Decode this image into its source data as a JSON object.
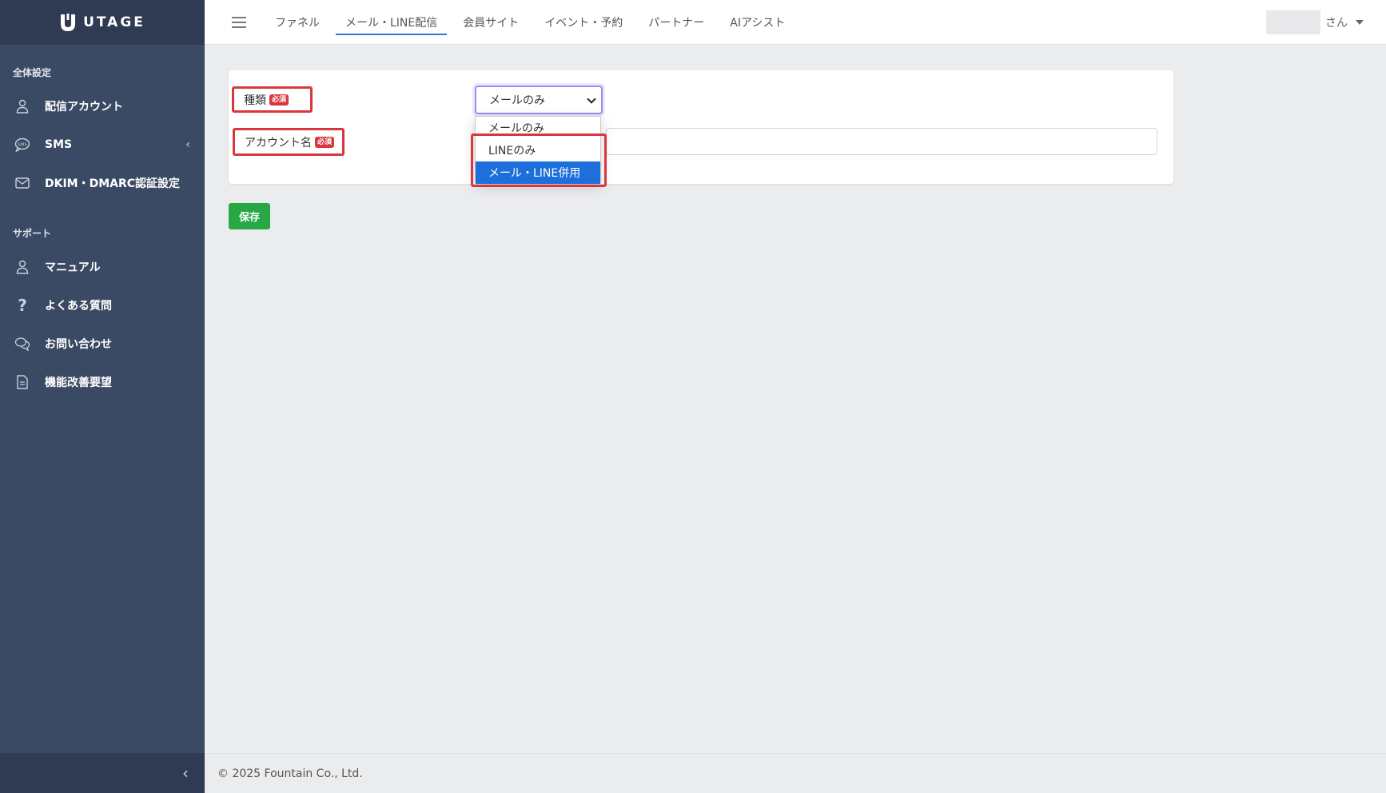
{
  "brand": {
    "name": "UTAGE"
  },
  "sidebar": {
    "section_general": "全体設定",
    "general_items": [
      {
        "label": "配信アカウント",
        "icon": "user-icon"
      },
      {
        "label": "SMS",
        "icon": "sms-bubble-icon",
        "has_chevron": true
      },
      {
        "label": "DKIM・DMARC認証設定",
        "icon": "envelope-icon"
      }
    ],
    "section_support": "サポート",
    "support_items": [
      {
        "label": "マニュアル",
        "icon": "user-icon"
      },
      {
        "label": "よくある質問",
        "icon": "question-icon"
      },
      {
        "label": "お問い合わせ",
        "icon": "chat-icon"
      },
      {
        "label": "機能改善要望",
        "icon": "document-icon"
      }
    ],
    "collapse_glyph": "‹"
  },
  "header": {
    "tabs": [
      {
        "label": "ファネル",
        "active": false
      },
      {
        "label": "メール・LINE配信",
        "active": true
      },
      {
        "label": "会員サイト",
        "active": false
      },
      {
        "label": "イベント・予約",
        "active": false
      },
      {
        "label": "パートナー",
        "active": false
      },
      {
        "label": "AIアシスト",
        "active": false
      }
    ],
    "user_suffix": "さん"
  },
  "form": {
    "type_label": "種類",
    "account_name_label": "アカウント名",
    "required_badge": "必須",
    "type_select": {
      "value": "メールのみ",
      "options": [
        "メールのみ",
        "LINEのみ",
        "メール・LINE併用"
      ],
      "highlighted_option": "メール・LINE併用"
    },
    "account_name_value": ""
  },
  "actions": {
    "save_label": "保存"
  },
  "footer": {
    "copyright": "© 2025 Fountain Co., Ltd."
  },
  "colors": {
    "sidebar_bg": "#3b4a64",
    "sidebar_dark": "#2f3b52",
    "accent_blue": "#1d6fdc",
    "highlight_red": "#d9363e",
    "save_green": "#28a745"
  }
}
